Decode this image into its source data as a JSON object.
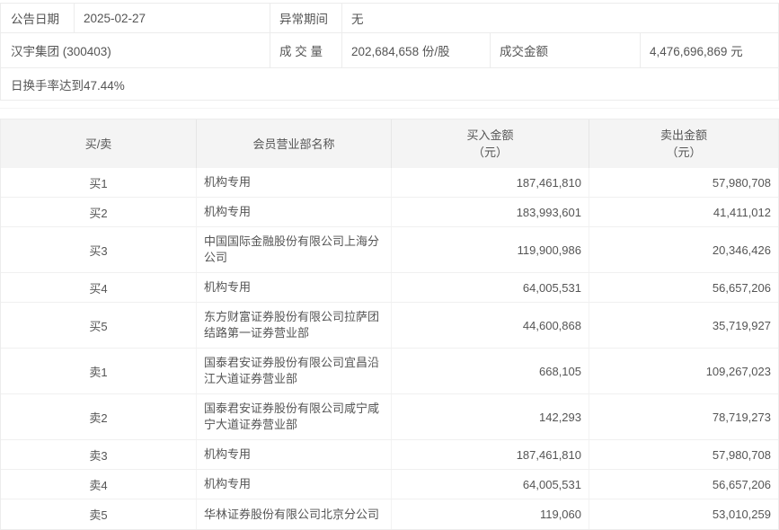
{
  "summary": {
    "row1": {
      "announce_date_label": "公告日期",
      "announce_date_value": "2025-02-27",
      "abnormal_period_label": "异常期间",
      "abnormal_period_value": "无"
    },
    "row2": {
      "stock_name": "汉宇集团 (300403)",
      "volume_label": "成 交 量",
      "volume_value": "202,684,658 份/股",
      "amount_label": "成交金额",
      "amount_value": "4,476,696,869 元"
    },
    "note": "日换手率达到47.44%"
  },
  "table": {
    "headers": {
      "side": "买/卖",
      "broker": "会员营业部名称",
      "buy_line1": "买入金额",
      "buy_line2": "（元）",
      "sell_line1": "卖出金额",
      "sell_line2": "（元）"
    },
    "rows": [
      {
        "side": "买1",
        "broker": "机构专用",
        "buy": "187,461,810",
        "sell": "57,980,708"
      },
      {
        "side": "买2",
        "broker": "机构专用",
        "buy": "183,993,601",
        "sell": "41,411,012"
      },
      {
        "side": "买3",
        "broker": "中国国际金融股份有限公司上海分公司",
        "buy": "119,900,986",
        "sell": "20,346,426"
      },
      {
        "side": "买4",
        "broker": "机构专用",
        "buy": "64,005,531",
        "sell": "56,657,206"
      },
      {
        "side": "买5",
        "broker": "东方财富证券股份有限公司拉萨团结路第一证券营业部",
        "buy": "44,600,868",
        "sell": "35,719,927"
      },
      {
        "side": "卖1",
        "broker": "国泰君安证券股份有限公司宜昌沿江大道证券营业部",
        "buy": "668,105",
        "sell": "109,267,023"
      },
      {
        "side": "卖2",
        "broker": "国泰君安证券股份有限公司咸宁咸宁大道证券营业部",
        "buy": "142,293",
        "sell": "78,719,273"
      },
      {
        "side": "卖3",
        "broker": "机构专用",
        "buy": "187,461,810",
        "sell": "57,980,708"
      },
      {
        "side": "卖4",
        "broker": "机构专用",
        "buy": "64,005,531",
        "sell": "56,657,206"
      },
      {
        "side": "卖5",
        "broker": "华林证券股份有限公司北京分公司",
        "buy": "119,060",
        "sell": "53,010,259"
      }
    ]
  },
  "colors": {
    "text": "#555555",
    "border": "#ececec",
    "header_bg": "#f4f4f4",
    "row_border": "#f0f0f0"
  }
}
